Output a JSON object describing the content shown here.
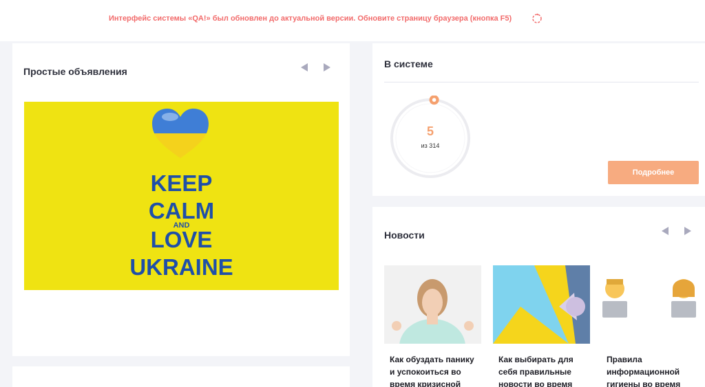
{
  "notice": {
    "text": "Интерфейс системы «QA!» был обновлен до актуальной версии. Обновите страницу браузера (кнопка F5)",
    "icon": "reload-icon"
  },
  "ads": {
    "title": "Простые объявления",
    "banner": {
      "line1": "KEEP",
      "line2": "CALM",
      "line3": "AND",
      "line4": "LOVE",
      "line5": "UKRAINE",
      "colors": {
        "background": "#efe312",
        "text": "#1f4fa8"
      }
    }
  },
  "system": {
    "title": "В системе",
    "online_count": "5",
    "total_label": "из 314",
    "online_fraction": 0.016,
    "button_label": "Подробнее"
  },
  "news": {
    "title": "Новости",
    "items": [
      {
        "title": "Как обуздать панику и успокоиться во время кризисной ситуации"
      },
      {
        "title": "Как выбирать для себя правильные новости во время войны?"
      },
      {
        "title": "Правила информационной гигиены во время"
      }
    ]
  },
  "colors": {
    "accent": "#f7ab80",
    "notice": "#f26b6b",
    "arrow": "#a9a9bd"
  }
}
